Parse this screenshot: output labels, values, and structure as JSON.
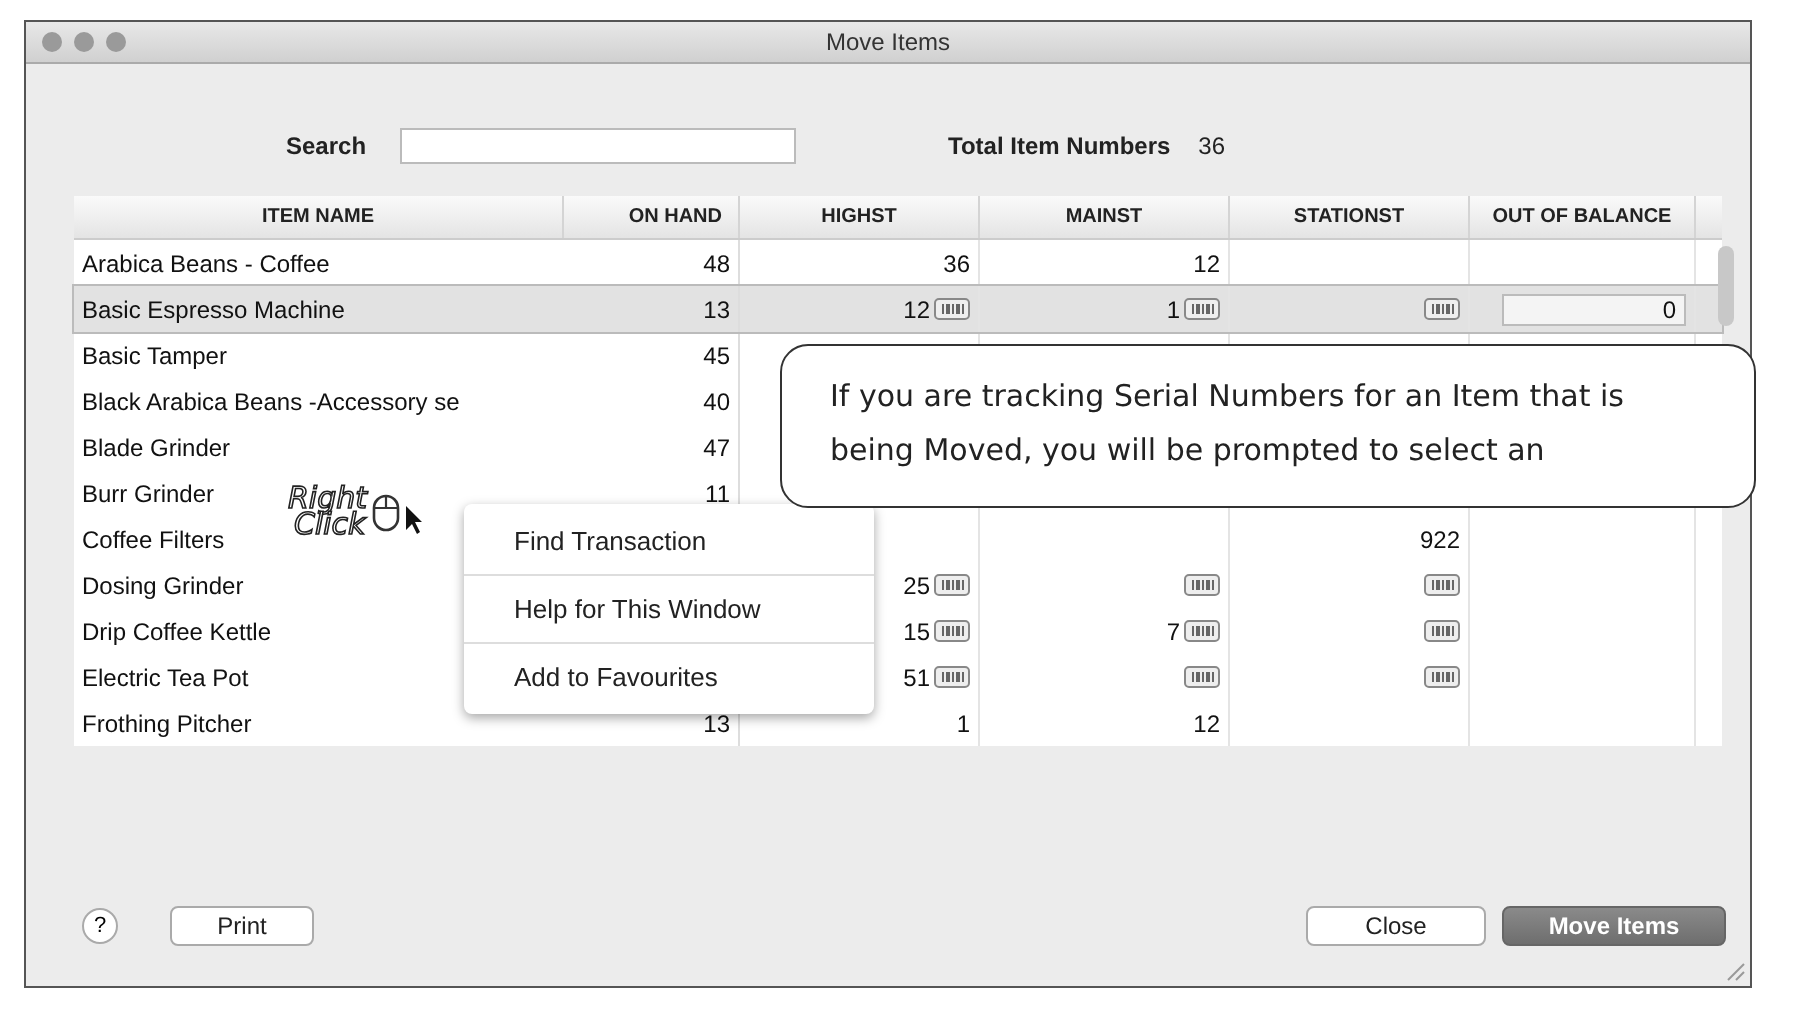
{
  "window": {
    "title": "Move Items"
  },
  "search": {
    "label": "Search"
  },
  "total": {
    "label": "Total Item Numbers",
    "value": "36"
  },
  "table": {
    "columns": [
      "ITEM NAME",
      "ON HAND",
      "HIGHST",
      "MAINST",
      "STATIONST",
      "OUT OF BALANCE"
    ],
    "rows": [
      {
        "selected": false,
        "cells": [
          {
            "kind": "name",
            "text": "Arabica Beans - Coffee"
          },
          {
            "kind": "count",
            "text": "48"
          },
          {
            "kind": "number",
            "text": "36",
            "serial": false
          },
          {
            "kind": "number",
            "text": "12",
            "serial": false
          },
          {
            "kind": "number",
            "serial": false
          },
          {
            "kind": "number",
            "serial": false
          }
        ]
      },
      {
        "selected": true,
        "cells": [
          {
            "kind": "name",
            "text": "Basic Espresso Machine"
          },
          {
            "kind": "count",
            "text": "13"
          },
          {
            "kind": "number",
            "text": "12",
            "serial": true
          },
          {
            "kind": "number",
            "text": "1",
            "serial": true
          },
          {
            "kind": "number",
            "serial": true
          },
          {
            "kind": "field",
            "text": "0",
            "serial": false
          }
        ]
      },
      {
        "selected": false,
        "cells": [
          {
            "kind": "name",
            "text": "Basic Tamper"
          },
          {
            "kind": "count",
            "text": "45"
          }
        ]
      },
      {
        "selected": false,
        "cells": [
          {
            "kind": "name",
            "text": "Black Arabica Beans -Accessory se"
          },
          {
            "kind": "count",
            "text": "40"
          }
        ]
      },
      {
        "selected": false,
        "cells": [
          {
            "kind": "name",
            "text": "Blade Grinder"
          },
          {
            "kind": "count",
            "text": "47"
          }
        ]
      },
      {
        "selected": false,
        "cells": [
          {
            "kind": "name",
            "text": "Burr Grinder"
          },
          {
            "kind": "count",
            "text": "11"
          }
        ]
      },
      {
        "selected": false,
        "cells": [
          {
            "kind": "name",
            "text": "Coffee Filters"
          },
          {
            "kind": "count"
          },
          {
            "kind": "number",
            "serial": false
          },
          {
            "kind": "number",
            "serial": false
          },
          {
            "kind": "number",
            "text": "922",
            "serial": false
          },
          {
            "kind": "number",
            "serial": false
          }
        ]
      },
      {
        "selected": false,
        "cells": [
          {
            "kind": "name",
            "text": "Dosing Grinder"
          },
          {
            "kind": "count"
          },
          {
            "kind": "number",
            "text": "25",
            "serial": true
          },
          {
            "kind": "number",
            "serial": true
          },
          {
            "kind": "number",
            "serial": true
          },
          {
            "kind": "number",
            "serial": false
          }
        ]
      },
      {
        "selected": false,
        "cells": [
          {
            "kind": "name",
            "text": "Drip Coffee Kettle"
          },
          {
            "kind": "count"
          },
          {
            "kind": "number",
            "text": "15",
            "serial": true
          },
          {
            "kind": "number",
            "text": "7",
            "serial": true
          },
          {
            "kind": "number",
            "serial": true
          },
          {
            "kind": "number",
            "serial": false
          }
        ]
      },
      {
        "selected": false,
        "cells": [
          {
            "kind": "name",
            "text": "Electric Tea Pot"
          },
          {
            "kind": "count"
          },
          {
            "kind": "number",
            "text": "51",
            "serial": true
          },
          {
            "kind": "number",
            "serial": true
          },
          {
            "kind": "number",
            "serial": true
          },
          {
            "kind": "number",
            "serial": false
          }
        ]
      },
      {
        "selected": false,
        "cells": [
          {
            "kind": "name",
            "text": "Frothing Pitcher"
          },
          {
            "kind": "count",
            "text": "13"
          },
          {
            "kind": "number",
            "text": "1",
            "serial": false
          },
          {
            "kind": "number",
            "text": "12",
            "serial": false
          },
          {
            "kind": "number",
            "serial": false
          },
          {
            "kind": "number",
            "serial": false
          }
        ]
      }
    ]
  },
  "context_menu": {
    "items": [
      "Find Transaction",
      "Help for This Window",
      "Add to Favourites"
    ]
  },
  "annotation": {
    "lines": [
      "Right",
      "Click"
    ]
  },
  "callout": {
    "text": "If you are tracking Serial Numbers for an Item that is being Moved, you will be prompted to select an"
  },
  "footer": {
    "help": "?",
    "print": "Print",
    "close": "Close",
    "move": "Move Items"
  }
}
